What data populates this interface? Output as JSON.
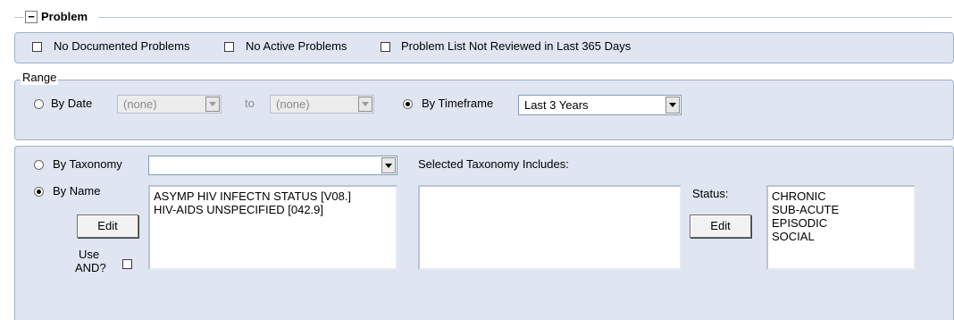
{
  "problem_section": {
    "collapse_glyph": "−",
    "title": "Problem"
  },
  "filters": {
    "no_documented": "No Documented Problems",
    "no_active": "No Active Problems",
    "not_reviewed": "Problem List Not Reviewed in Last 365 Days"
  },
  "range": {
    "title": "Range",
    "by_date_label": "By Date",
    "from_value": "(none)",
    "to_label": "to",
    "to_value": "(none)",
    "by_timeframe_label": "By Timeframe",
    "timeframe_value": "Last 3 Years"
  },
  "criteria": {
    "by_taxonomy_label": "By Taxonomy",
    "taxonomy_value": "",
    "selected_taxonomy_label": "Selected Taxonomy Includes:",
    "by_name_label": "By Name",
    "edit_label": "Edit",
    "use_and_label_1": "Use",
    "use_and_label_2": "AND?",
    "names": [
      "ASYMP HIV INFECTN STATUS [V08.]",
      "HIV-AIDS UNSPECIFIED [042.9]"
    ],
    "status_label": "Status:",
    "status_edit_label": "Edit",
    "statuses": [
      "CHRONIC",
      "SUB-ACUTE",
      "EPISODIC",
      "SOCIAL"
    ]
  }
}
